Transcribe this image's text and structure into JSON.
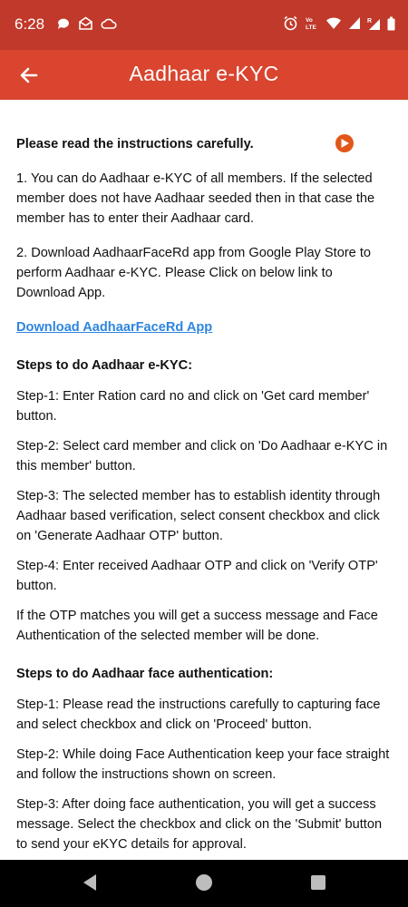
{
  "status_bar": {
    "time": "6:28",
    "left_icons": [
      "chat-icon",
      "mail-icon",
      "cloud-icon"
    ],
    "right_icons": [
      "alarm-icon",
      "volte-icon",
      "wifi-icon",
      "signal-icon",
      "signal-roaming-icon",
      "battery-icon"
    ]
  },
  "app_bar": {
    "title": "Aadhaar e-KYC",
    "back_icon": "back-arrow-icon"
  },
  "content": {
    "heading": "Please read the instructions carefully.",
    "play_icon": "play-circle-icon",
    "para1": "1. You can do Aadhaar e-KYC of all members. If the selected member does not have Aadhaar seeded then in that case the member has to enter their Aadhaar card.",
    "para2": "2. Download AadhaarFaceRd app from Google Play Store to perform Aadhaar e-KYC. Please Click on below link to Download App.",
    "download_link": "Download AadhaarFaceRd App",
    "ekyc_steps_title": "Steps to do Aadhaar e-KYC:",
    "ekyc_steps": [
      "Step-1: Enter Ration card no and click on 'Get card member' button.",
      "Step-2: Select card member and click on 'Do Aadhaar e-KYC in this member' button.",
      "Step-3: The selected member has to establish identity through Aadhaar based verification, select consent checkbox and click on 'Generate Aadhaar OTP' button.",
      "Step-4: Enter received Aadhaar OTP and click on 'Verify OTP' button.",
      "If the OTP matches you will get a success message and Face Authentication of the selected member will be done."
    ],
    "face_steps_title": "Steps to do Aadhaar face authentication:",
    "face_steps": [
      "Step-1: Please read the instructions carefully to capturing face and select checkbox and click on 'Proceed' button.",
      "Step-2: While doing Face Authentication keep your face straight and follow the instructions shown on screen.",
      "Step-3: After doing face authentication, you will get a success message. Select the checkbox and click on the 'Submit' button to send your eKYC details for approval."
    ]
  },
  "nav_bar": {
    "icons": [
      "nav-back-icon",
      "nav-home-icon",
      "nav-recents-icon"
    ]
  },
  "colors": {
    "app_bar": "#d9452f",
    "status_bar": "#c0392b",
    "link": "#2e86de",
    "play_button": "#e2561a"
  }
}
